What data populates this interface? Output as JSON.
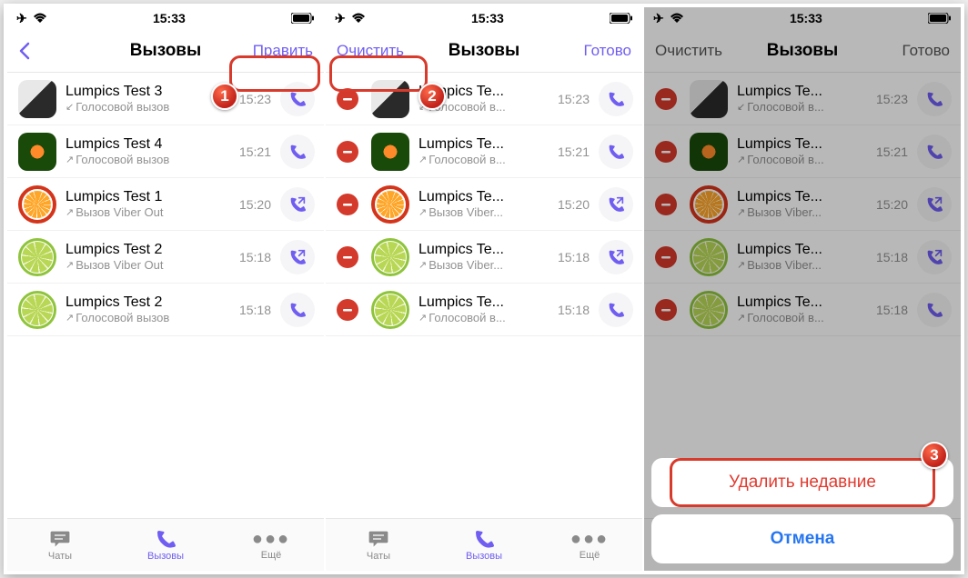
{
  "statusbar": {
    "time": "15:33"
  },
  "nav": {
    "title": "Вызовы",
    "edit": "Править",
    "clear": "Очистить",
    "done": "Готово"
  },
  "tabs": {
    "chats": "Чаты",
    "calls": "Вызовы",
    "more": "Ещё"
  },
  "actionsheet": {
    "delete": "Удалить недавние",
    "cancel": "Отмена"
  },
  "calls_full": [
    {
      "name": "Lumpics Test 3",
      "sub": "Голосовой вызов",
      "dir": "in",
      "time": "15:23",
      "avatar": "av-laptop",
      "icon": "phone"
    },
    {
      "name": "Lumpics Test 4",
      "sub": "Голосовой вызов",
      "dir": "out",
      "time": "15:21",
      "avatar": "av-orange",
      "icon": "phone"
    },
    {
      "name": "Lumpics Test 1",
      "sub": "Вызов Viber Out",
      "dir": "out",
      "time": "15:20",
      "avatar": "av-citrus",
      "icon": "phone-out"
    },
    {
      "name": "Lumpics Test 2",
      "sub": "Вызов Viber Out",
      "dir": "out",
      "time": "15:18",
      "avatar": "av-lime",
      "icon": "phone-out"
    },
    {
      "name": "Lumpics Test 2",
      "sub": "Голосовой вызов",
      "dir": "out",
      "time": "15:18",
      "avatar": "av-lime",
      "icon": "phone"
    }
  ],
  "calls_trunc": [
    {
      "name": "Lumpics Te...",
      "sub": "Голосовой в...",
      "dir": "in",
      "time": "15:23",
      "avatar": "av-laptop",
      "icon": "phone"
    },
    {
      "name": "Lumpics Te...",
      "sub": "Голосовой в...",
      "dir": "out",
      "time": "15:21",
      "avatar": "av-orange",
      "icon": "phone"
    },
    {
      "name": "Lumpics Te...",
      "sub": "Вызов Viber...",
      "dir": "out",
      "time": "15:20",
      "avatar": "av-citrus",
      "icon": "phone-out"
    },
    {
      "name": "Lumpics Te...",
      "sub": "Вызов Viber...",
      "dir": "out",
      "time": "15:18",
      "avatar": "av-lime",
      "icon": "phone-out"
    },
    {
      "name": "Lumpics Te...",
      "sub": "Голосовой в...",
      "dir": "out",
      "time": "15:18",
      "avatar": "av-lime",
      "icon": "phone"
    }
  ],
  "badges": {
    "b1": "1",
    "b2": "2",
    "b3": "3"
  }
}
